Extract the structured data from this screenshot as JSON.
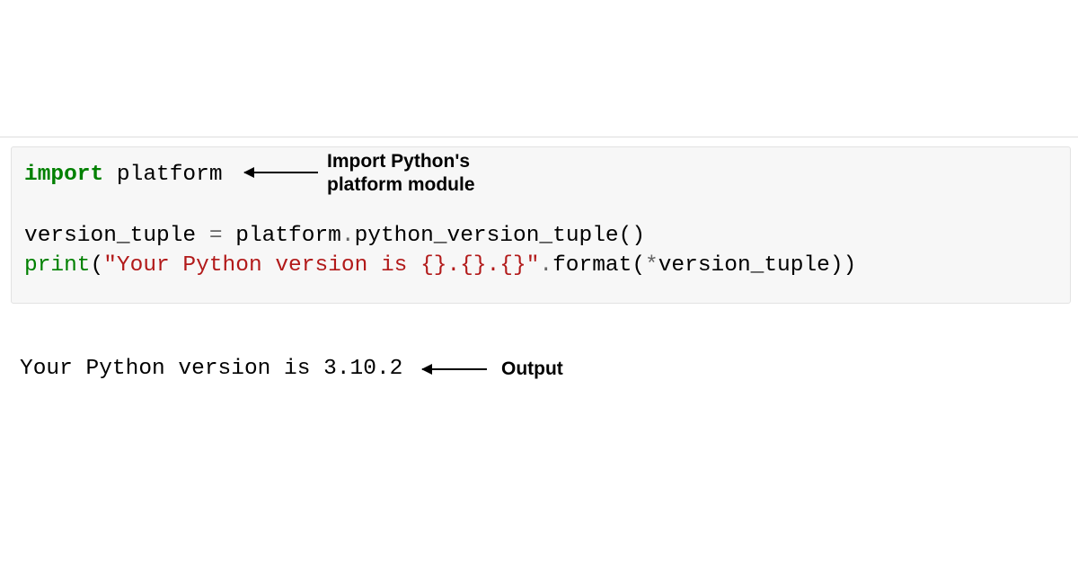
{
  "code": {
    "line1": {
      "import_kw": "import",
      "module": " platform"
    },
    "blank": "",
    "line2": {
      "var": "version_tuple ",
      "eq": "=",
      "rest": " platform",
      "dot1": ".",
      "call": "python_version_tuple()"
    },
    "line3": {
      "print_fn": "print",
      "open": "(",
      "str": "\"Your Python version is {}.{}.{}\"",
      "dot": ".",
      "format_fn": "format(",
      "star": "*",
      "arg": "version_tuple))"
    }
  },
  "output": "Your Python version is 3.10.2",
  "annotations": {
    "import": "Import Python's\nplatform module",
    "output": "Output"
  }
}
